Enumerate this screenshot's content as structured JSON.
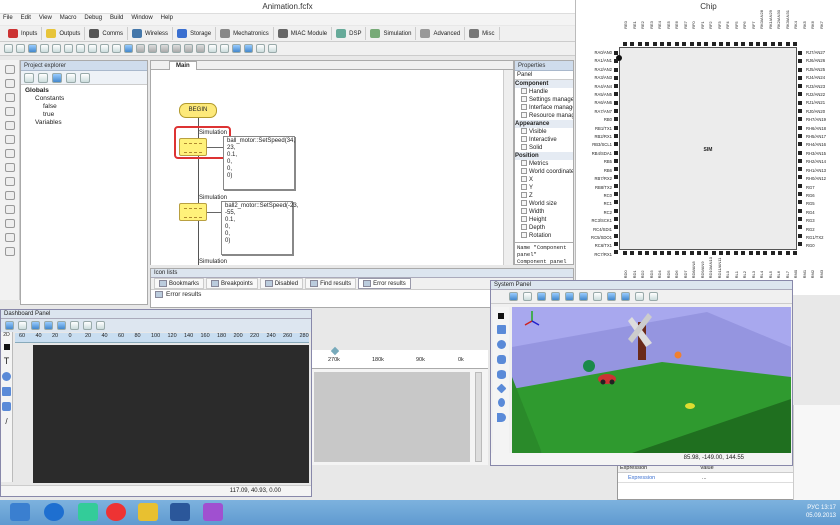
{
  "window": {
    "title": "Animation.fcfx"
  },
  "menu": [
    "File",
    "Edit",
    "View",
    "Macro",
    "Debug",
    "Build",
    "Window",
    "Help"
  ],
  "toolbar": [
    "Inputs",
    "Outputs",
    "Comms",
    "Wireless",
    "Storage",
    "Mechatronics",
    "MIAC Module",
    "DSP",
    "Simulation",
    "Advanced",
    "Misc"
  ],
  "project_explorer": {
    "title": "Project explorer",
    "globals": "Globals",
    "constants": "Constants",
    "false_label": "false",
    "true_label": "true",
    "variables": "Variables"
  },
  "editor": {
    "tab": "Main",
    "begin": "BEGIN",
    "sim1": "Simulation",
    "sim2": "Simulation",
    "sim3": "Simulation",
    "note1": [
      "ball_motor::SetSpeed(34,",
      "23,",
      "0.1,",
      "0,",
      "0,",
      "0)"
    ],
    "note2": [
      "ball2_motor::SetSpeed(-23,",
      "-55,",
      "0.1,",
      "0,",
      "0,",
      "0)"
    ]
  },
  "properties": {
    "title": "Properties",
    "panel": "Panel",
    "rows": [
      {
        "t": "Component",
        "cat": true
      },
      {
        "t": "Handle"
      },
      {
        "t": "Settings manager"
      },
      {
        "t": "Interface manager"
      },
      {
        "t": "Resource manager"
      },
      {
        "t": "Appearance",
        "cat": true
      },
      {
        "t": "Visible"
      },
      {
        "t": "Interactive"
      },
      {
        "t": "Solid"
      },
      {
        "t": "Position",
        "cat": true
      },
      {
        "t": "Metrics"
      },
      {
        "t": "World coordinates"
      },
      {
        "t": "X"
      },
      {
        "t": "Y"
      },
      {
        "t": "Z"
      },
      {
        "t": "World size"
      },
      {
        "t": "Width"
      },
      {
        "t": "Height"
      },
      {
        "t": "Depth"
      },
      {
        "t": "Rotation"
      }
    ],
    "desc_name": "Name",
    "desc_value": "\"Component panel\"",
    "desc_text": "Component panel"
  },
  "chip": {
    "title": "Chip",
    "label": "SIM",
    "left_pins": [
      "RA0/AN0",
      "RA1/AN1",
      "RA2/AN2",
      "RA3/AN3",
      "RA4/AN4",
      "RA5/AN5",
      "RA6/AN6",
      "RA7/AN7",
      "RB0",
      "RB1/TX1",
      "RB2/RX1",
      "RB3/SCL1",
      "RB4/SDA1",
      "RB5",
      "RB6",
      "RB7/RX2",
      "RB8/TX2",
      "RC0",
      "RC1",
      "RC2",
      "RC3/SCK1",
      "RC4/SDI1",
      "RC5/SDO1",
      "RC6/TX1",
      "RC7/RX1"
    ],
    "right_pins": [
      "RJ7/AN27",
      "RJ6/AN26",
      "RJ5/AN25",
      "RJ4/AN24",
      "RJ3/AN23",
      "RJ2/AN22",
      "RJ1/AN21",
      "RJ0/AN20",
      "RH7/AN19",
      "RH6/AN18",
      "RH5/AN17",
      "RH4/AN16",
      "RH3/AN15",
      "RH2/AN14",
      "RH1/AN13",
      "RH0/AN12",
      "RG7",
      "RG6",
      "RG5",
      "RG4",
      "RG3",
      "RG2",
      "RG1/TX2",
      "RG0"
    ],
    "top_pins": [
      "RE0",
      "RE1",
      "RE2",
      "RE3",
      "RE4",
      "RE5",
      "RE6",
      "RE7",
      "RF0",
      "RF1",
      "RF2",
      "RF3",
      "RF4",
      "RF5",
      "RF6",
      "RF7",
      "RK0/AN28",
      "RK1/AN29",
      "RK2/AN30",
      "RK3/AN31",
      "RK4",
      "RK5",
      "RK6",
      "RK7"
    ],
    "bottom_pins": [
      "RD0",
      "RD1",
      "RD2",
      "RD3",
      "RD4",
      "RD5",
      "RD6",
      "RD7",
      "RD8/AN8",
      "RD9/AN9",
      "RD10/AN10",
      "RD11/AN11",
      "RL0",
      "RL1",
      "RL2",
      "RL3",
      "RL4",
      "RL5",
      "RL6",
      "RL7",
      "RM0",
      "RM1",
      "RM2",
      "RM3"
    ]
  },
  "bottom_panel": {
    "title": "Icon lists",
    "tabs": [
      "Bookmarks",
      "Breakpoints",
      "Disabled",
      "Find results",
      "Error results"
    ],
    "heading": "Error results"
  },
  "dashboard": {
    "title": "Dashboard Panel",
    "view": "2D",
    "ruler": [
      "60",
      "40",
      "20",
      "0",
      "20",
      "40",
      "60",
      "80",
      "100",
      "120",
      "140",
      "160",
      "180",
      "200",
      "220",
      "240",
      "260",
      "280"
    ],
    "status": "117.09, 40.93, 0.00"
  },
  "graph": {
    "ticks": [
      "270k",
      "180k",
      "90k",
      "0k"
    ]
  },
  "system_panel": {
    "title": "System Panel",
    "status": "85.98, -149.00, 144.55"
  },
  "watch": {
    "col_expression": "Expression",
    "col_value": "Value",
    "row_expression": "Expression",
    "row_value": "..."
  },
  "taskbar": {
    "lang": "РУС",
    "time": "13:17",
    "date": "05.09.2013"
  },
  "colors": {
    "floor_green": "#2f9a2f",
    "floor_dark": "#1f6f1f",
    "sky": "#a8a8ee",
    "dash_bg": "#2b2b2b"
  }
}
